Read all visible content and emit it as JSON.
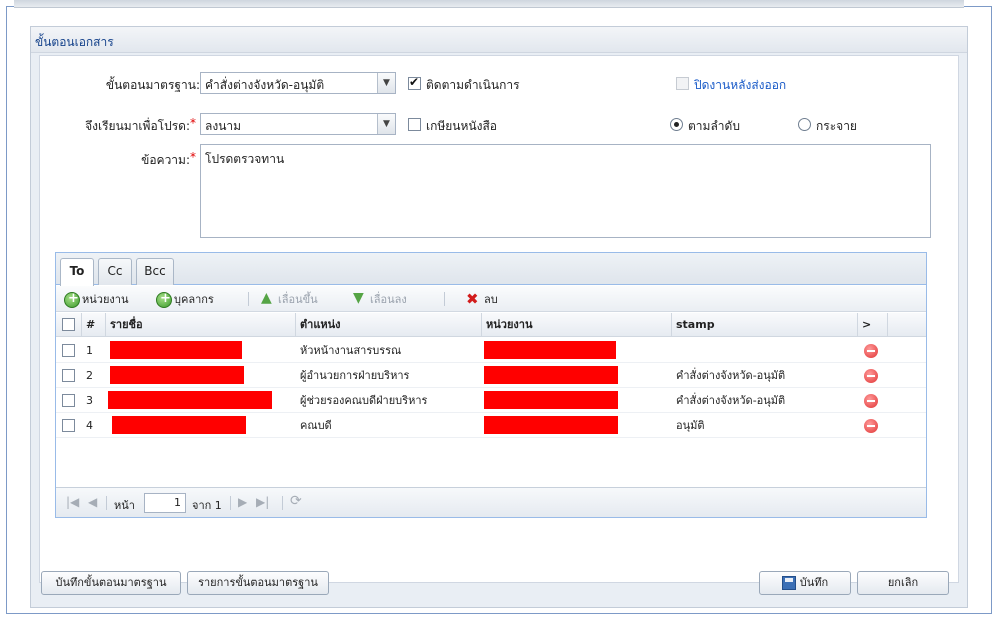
{
  "window": {
    "title": "ขั้นตอนเอกสาร"
  },
  "form": {
    "standard_step_label": "ขั้นตอนมาตรฐาน:",
    "standard_step_value": "คำสั่งต่างจังหวัด-อนุมัติ",
    "track_progress_label": "ติดตามดำเนินการ",
    "track_progress_checked": true,
    "close_after_send_label": "ปิดงานหลังส่งออก",
    "close_after_send_enabled": false,
    "submit_for_label": "จึงเรียนมาเพื่อโปรด:",
    "submit_for_value": "ลงนาม",
    "write_letter_label": "เกษียนหนังสือ",
    "write_letter_checked": false,
    "order_sequential_label": "ตามลำดับ",
    "order_distribute_label": "กระจาย",
    "order_selected": "sequential",
    "message_label": "ข้อความ:",
    "message_value": "โปรดตรวจทาน",
    "required_mark": "*"
  },
  "tabs": [
    {
      "label": "To",
      "active": true
    },
    {
      "label": "Cc",
      "active": false
    },
    {
      "label": "Bcc",
      "active": false
    }
  ],
  "toolbar": {
    "add_unit": "หน่วยงาน",
    "add_person": "บุคลากร",
    "move_up": "เลื่อนขึ้น",
    "move_down": "เลื่อนลง",
    "delete": "ลบ"
  },
  "grid": {
    "columns": {
      "num": "#",
      "name": "รายชื่อ",
      "position": "ตำแหน่ง",
      "unit": "หน่วยงาน",
      "stamp": "stamp",
      "more": ">"
    },
    "rows": [
      {
        "num": "1",
        "position": "หัวหน้างานสารบรรณ",
        "stamp": ""
      },
      {
        "num": "2",
        "position": "ผู้อำนวยการฝ่ายบริหาร",
        "stamp": "คำสั่งต่างจังหวัด-อนุมัติ"
      },
      {
        "num": "3",
        "position": "ผู้ช่วยรองคณบดีฝ่ายบริหาร",
        "stamp": "คำสั่งต่างจังหวัด-อนุมัติ"
      },
      {
        "num": "4",
        "position": "คณบดี",
        "stamp": "อนุมัติ"
      }
    ],
    "redaction_color": "#ff0000"
  },
  "pager": {
    "page_label": "หน้า",
    "page_value": "1",
    "of_label": "จาก 1"
  },
  "footer": {
    "save_standard": "บันทึกขั้นตอนมาตรฐาน",
    "standard_list": "รายการขั้นตอนมาตรฐาน",
    "save": "บันทึก",
    "cancel": "ยกเลิก"
  }
}
